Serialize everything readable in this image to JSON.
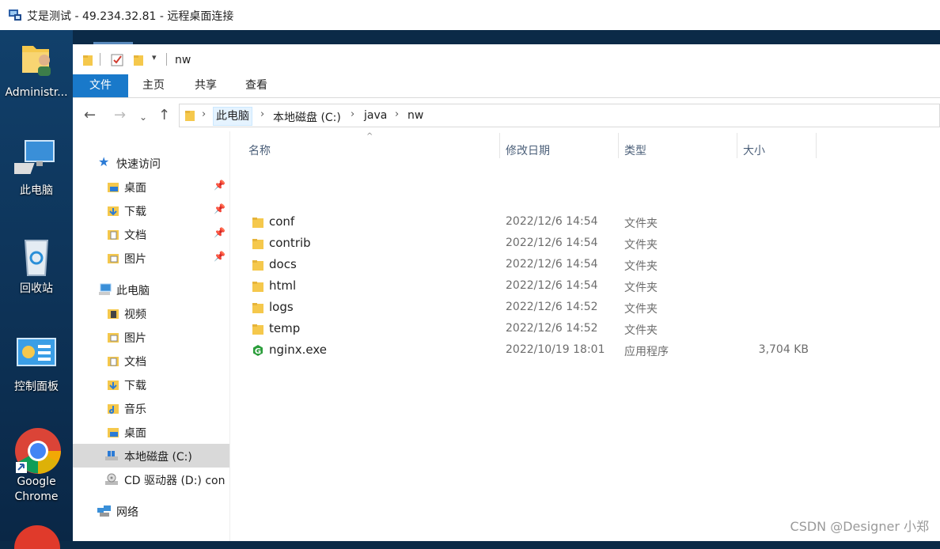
{
  "rdp": {
    "title": "艾是测试 - 49.234.32.81 - 远程桌面连接"
  },
  "desktop": {
    "items": [
      {
        "label": "Administr...",
        "icon": "user-folder-icon"
      },
      {
        "label": "此电脑",
        "icon": "computer-icon"
      },
      {
        "label": "回收站",
        "icon": "recycle-bin-icon"
      },
      {
        "label": "控制面板",
        "icon": "control-panel-icon"
      },
      {
        "label": "Google\nChrome",
        "icon": "chrome-icon"
      }
    ]
  },
  "window": {
    "title": "nw"
  },
  "ribbon": {
    "tabs": [
      "文件",
      "主页",
      "共享",
      "查看"
    ]
  },
  "address": {
    "crumbs": [
      "此电脑",
      "本地磁盘 (C:)",
      "java",
      "nw"
    ]
  },
  "nav": {
    "quick_access": "快速访问",
    "quick_items": [
      "桌面",
      "下载",
      "文档",
      "图片"
    ],
    "this_pc": "此电脑",
    "pc_items": [
      "视频",
      "图片",
      "文档",
      "下载",
      "音乐",
      "桌面",
      "本地磁盘 (C:)",
      "CD 驱动器 (D:) con"
    ],
    "network": "网络"
  },
  "columns": {
    "name": "名称",
    "date": "修改日期",
    "type": "类型",
    "size": "大小"
  },
  "files": [
    {
      "name": "conf",
      "date": "2022/12/6 14:54",
      "type": "文件夹",
      "size": "",
      "icon": "folder-icon"
    },
    {
      "name": "contrib",
      "date": "2022/12/6 14:54",
      "type": "文件夹",
      "size": "",
      "icon": "folder-icon"
    },
    {
      "name": "docs",
      "date": "2022/12/6 14:54",
      "type": "文件夹",
      "size": "",
      "icon": "folder-icon"
    },
    {
      "name": "html",
      "date": "2022/12/6 14:54",
      "type": "文件夹",
      "size": "",
      "icon": "folder-icon"
    },
    {
      "name": "logs",
      "date": "2022/12/6 14:52",
      "type": "文件夹",
      "size": "",
      "icon": "folder-icon"
    },
    {
      "name": "temp",
      "date": "2022/12/6 14:52",
      "type": "文件夹",
      "size": "",
      "icon": "folder-icon"
    },
    {
      "name": "nginx.exe",
      "date": "2022/10/19 18:01",
      "type": "应用程序",
      "size": "3,704 KB",
      "icon": "nginx-icon"
    }
  ],
  "watermark": "CSDN @Designer 小郑",
  "colors": {
    "accent": "#1979ca",
    "folder": "#f5c84c",
    "nginx": "#2a9d3a"
  }
}
